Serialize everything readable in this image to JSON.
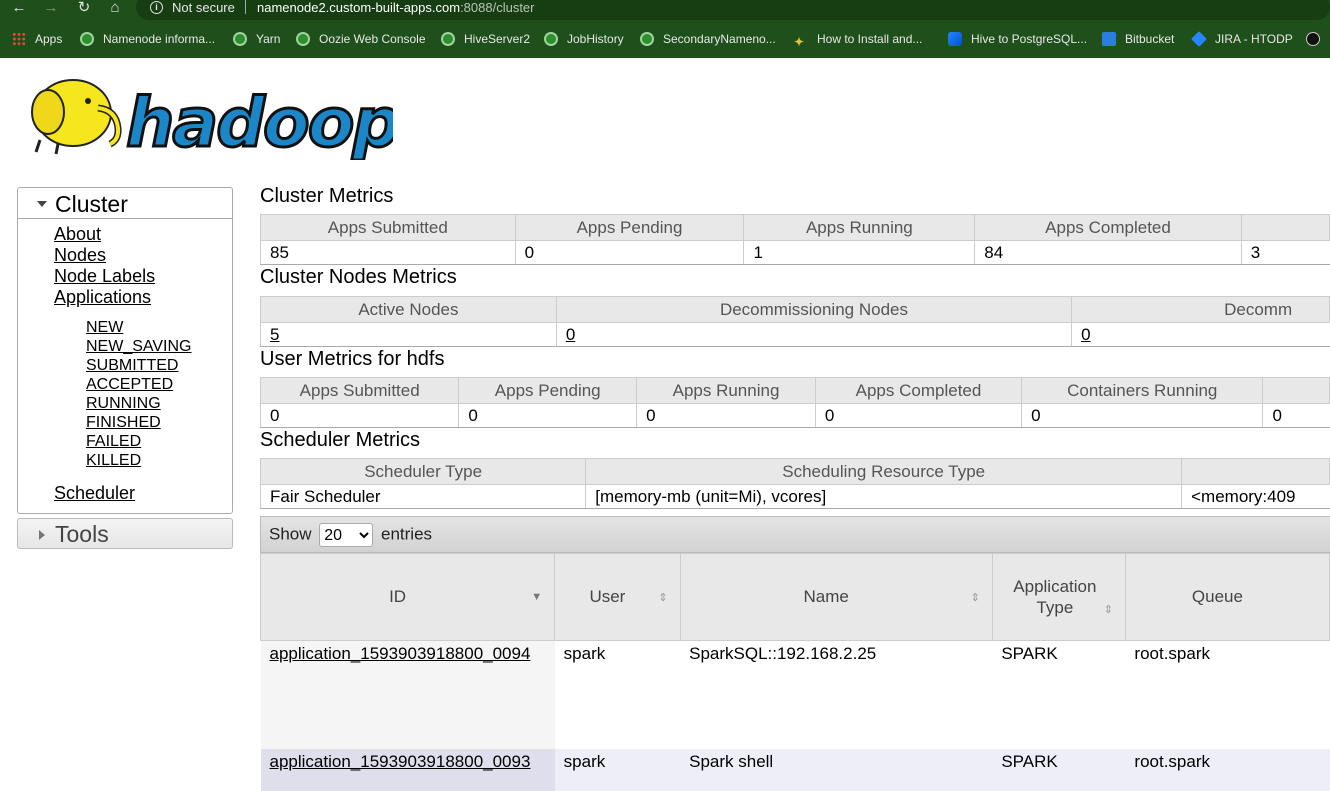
{
  "browser": {
    "security": "Not secure",
    "url_host": "namenode2.custom-built-apps.com",
    "url_rest": ":8088/cluster",
    "bookmarks": [
      {
        "label": "Apps",
        "icon": "apps-grid-icon"
      },
      {
        "label": "Namenode informa...",
        "icon": "globe-icon"
      },
      {
        "label": "Yarn",
        "icon": "globe-icon"
      },
      {
        "label": "Oozie Web Console",
        "icon": "globe-icon"
      },
      {
        "label": "HiveServer2",
        "icon": "globe-icon"
      },
      {
        "label": "JobHistory",
        "icon": "globe-icon"
      },
      {
        "label": "SecondaryNameno...",
        "icon": "globe-icon"
      },
      {
        "label": "How to Install and...",
        "icon": "sql-icon"
      },
      {
        "label": "Hive to PostgreSQL...",
        "icon": "confluence-icon"
      },
      {
        "label": "Bitbucket",
        "icon": "bitbucket-icon"
      },
      {
        "label": "JIRA - HTODP",
        "icon": "jira-icon"
      }
    ]
  },
  "logo_text": "hadoop",
  "nav": {
    "cluster_title": "Cluster",
    "links": [
      "About",
      "Nodes",
      "Node Labels",
      "Applications"
    ],
    "app_states": [
      "NEW",
      "NEW_SAVING",
      "SUBMITTED",
      "ACCEPTED",
      "RUNNING",
      "FINISHED",
      "FAILED",
      "KILLED"
    ],
    "scheduler": "Scheduler",
    "tools_title": "Tools"
  },
  "cluster_metrics": {
    "title": "Cluster Metrics",
    "headers": [
      "Apps Submitted",
      "Apps Pending",
      "Apps Running",
      "Apps Completed",
      ""
    ],
    "values": [
      "85",
      "0",
      "1",
      "84",
      "3"
    ]
  },
  "node_metrics": {
    "title": "Cluster Nodes Metrics",
    "headers": [
      "Active Nodes",
      "Decommissioning Nodes",
      "Decomm"
    ],
    "values": [
      "5",
      "0",
      "0"
    ]
  },
  "user_metrics": {
    "title": "User Metrics for hdfs",
    "headers": [
      "Apps Submitted",
      "Apps Pending",
      "Apps Running",
      "Apps Completed",
      "Containers Running",
      ""
    ],
    "values": [
      "0",
      "0",
      "0",
      "0",
      "0",
      "0"
    ]
  },
  "scheduler_metrics": {
    "title": "Scheduler Metrics",
    "headers": [
      "Scheduler Type",
      "Scheduling Resource Type",
      ""
    ],
    "values": [
      "Fair Scheduler",
      "[memory-mb (unit=Mi), vcores]",
      "<memory:409"
    ]
  },
  "datatable": {
    "show_label": "Show",
    "entries_value": "20",
    "entries_label": "entries",
    "headers": [
      "ID",
      "User",
      "Name",
      "Application Type",
      "Queue"
    ],
    "rows": [
      {
        "id": "application_1593903918800_0094",
        "user": "spark",
        "name": "SparkSQL::192.168.2.25",
        "type": "SPARK",
        "queue": "root.spark"
      },
      {
        "id": "application_1593903918800_0093",
        "user": "spark",
        "name": "Spark shell",
        "type": "SPARK",
        "queue": "root.spark"
      }
    ]
  }
}
